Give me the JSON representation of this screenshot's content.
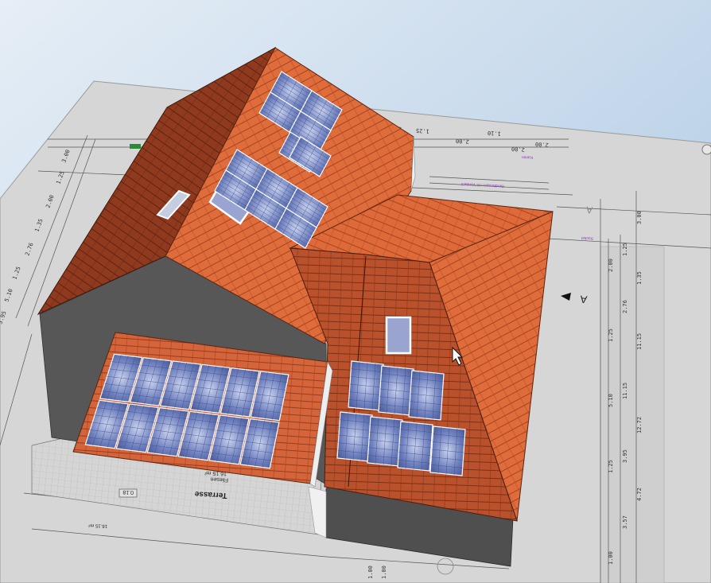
{
  "scene": {
    "background_top": "#e4ecf4",
    "background_bottom": "#aac6e2",
    "plan_color": "#d7d7d7",
    "roof_color": "#dd6b3a",
    "roof_shadow_color": "#9a3f20",
    "panel_color": "#5b6eaf",
    "wall_color": "#575757"
  },
  "plan": {
    "room_label": "Terrasse",
    "room_sub1": "Fliesen",
    "room_sub2": "16.15 m²",
    "room_code": "0.18",
    "section_marker": "A",
    "section_marker2": "A",
    "dims_right": [
      "3.00",
      "1.25",
      "2.00",
      "1.35",
      "2.76",
      "1.25",
      "11.15",
      "11.15",
      "5.10",
      "12.72",
      "3.95",
      "1.25",
      "4.72",
      "3.57",
      "1.00"
    ],
    "dims_left": [
      "3.00",
      "1.25",
      "2.00",
      "1.35",
      "2.76",
      "1.25",
      "5.10",
      "3.95"
    ],
    "dims_top": [
      "3.00",
      "1.25",
      "2.00",
      "1.10",
      "2.00",
      "2.00"
    ],
    "dims_bottom": [
      "1.00",
      "1.00"
    ],
    "bottom_left_note": "16.15 m²",
    "purple_note1": "Geräteraum mit Vordach",
    "purple_note2": "Kamin",
    "purple_note3": "Sockel"
  },
  "counts": {
    "main_roof_panels": 14,
    "terrace_panels": 12,
    "wing_panels": 7
  }
}
